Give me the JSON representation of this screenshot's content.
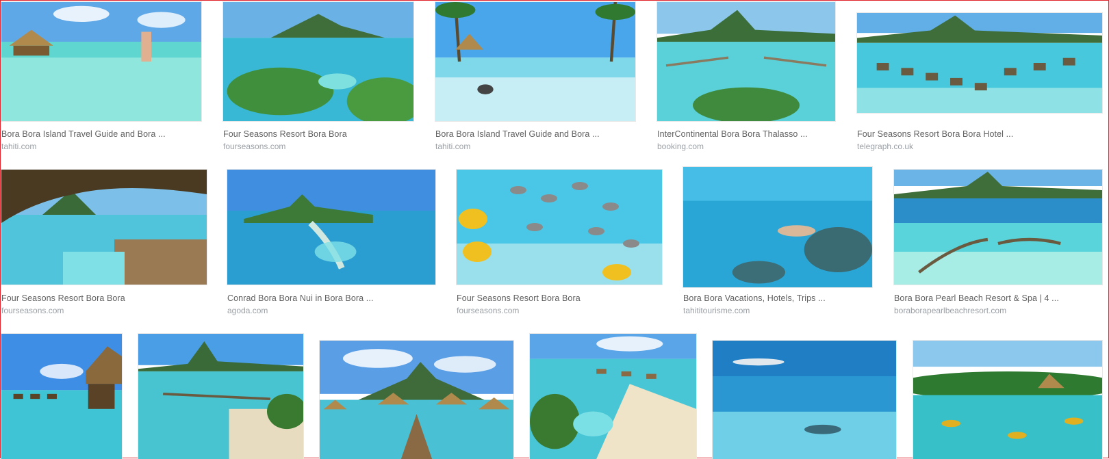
{
  "results": [
    {
      "title": "Bora Bora Island Travel Guide and Bora ...",
      "domain": "tahiti.com"
    },
    {
      "title": "Four Seasons Resort Bora Bora",
      "domain": "fourseasons.com"
    },
    {
      "title": "Bora Bora Island Travel Guide and Bora ...",
      "domain": "tahiti.com"
    },
    {
      "title": "InterContinental Bora Bora Thalasso ...",
      "domain": "booking.com"
    },
    {
      "title": "Four Seasons Resort Bora Bora Hotel ...",
      "domain": "telegraph.co.uk"
    },
    {
      "title": "Four Seasons Resort Bora Bora",
      "domain": "fourseasons.com"
    },
    {
      "title": "Conrad Bora Bora Nui in Bora Bora ...",
      "domain": "agoda.com"
    },
    {
      "title": "Four Seasons Resort Bora Bora",
      "domain": "fourseasons.com"
    },
    {
      "title": "Bora Bora Vacations, Hotels, Trips ...",
      "domain": "tahititourisme.com"
    },
    {
      "title": "Bora Bora Pearl Beach Resort & Spa | 4 ...",
      "domain": "boraborapearlbeachresort.com"
    }
  ]
}
